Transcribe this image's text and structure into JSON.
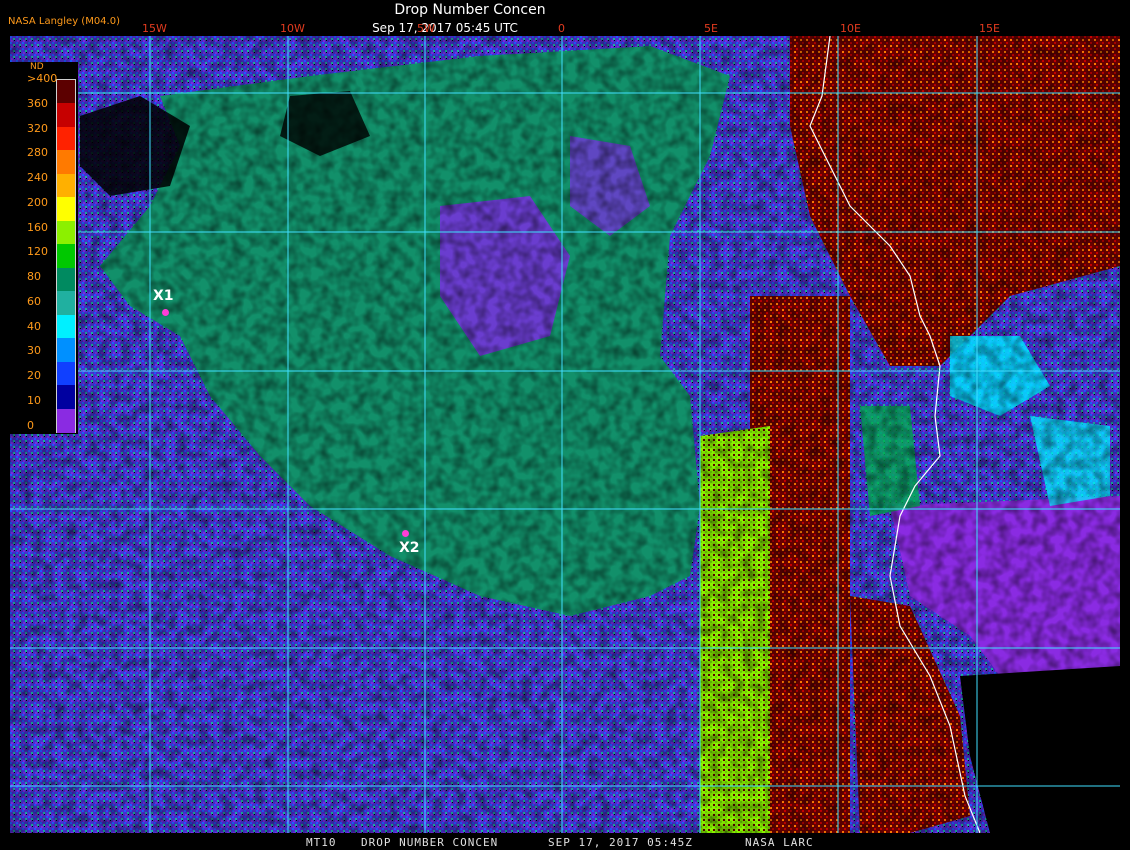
{
  "header": {
    "credit": "NASA Langley (M04.0)",
    "title": "Drop Number Concen",
    "datetime": "Sep 17, 2017 05:45 UTC"
  },
  "longitude_labels": [
    "15W",
    "10W",
    "5W",
    "0",
    "5E",
    "10E",
    "15E"
  ],
  "legend": {
    "title": "ND",
    "labels": [
      ">400",
      "360",
      "320",
      "280",
      "240",
      "200",
      "160",
      "120",
      "80",
      "60",
      "40",
      "30",
      "20",
      "10",
      "0"
    ],
    "colors": [
      "#5c0000",
      "#c60000",
      "#ff2200",
      "#ff7a00",
      "#ffb000",
      "#ffff00",
      "#8cf000",
      "#00c800",
      "#008a60",
      "#20b0a0",
      "#00f0ff",
      "#0090ff",
      "#1040ff",
      "#0000a0",
      "#8a2be2"
    ]
  },
  "markers": [
    {
      "label": "X1"
    },
    {
      "label": "X2"
    }
  ],
  "map_colors": {
    "grid": "#40e0ff",
    "coast": "#ffffff",
    "land_hot": "#6a0000",
    "cloud_mid": "#12906a"
  },
  "footer": {
    "product": "MT10",
    "field": "DROP NUMBER CONCEN",
    "date": "SEP 17, 2017 05:45Z",
    "source": "NASA LARC"
  }
}
